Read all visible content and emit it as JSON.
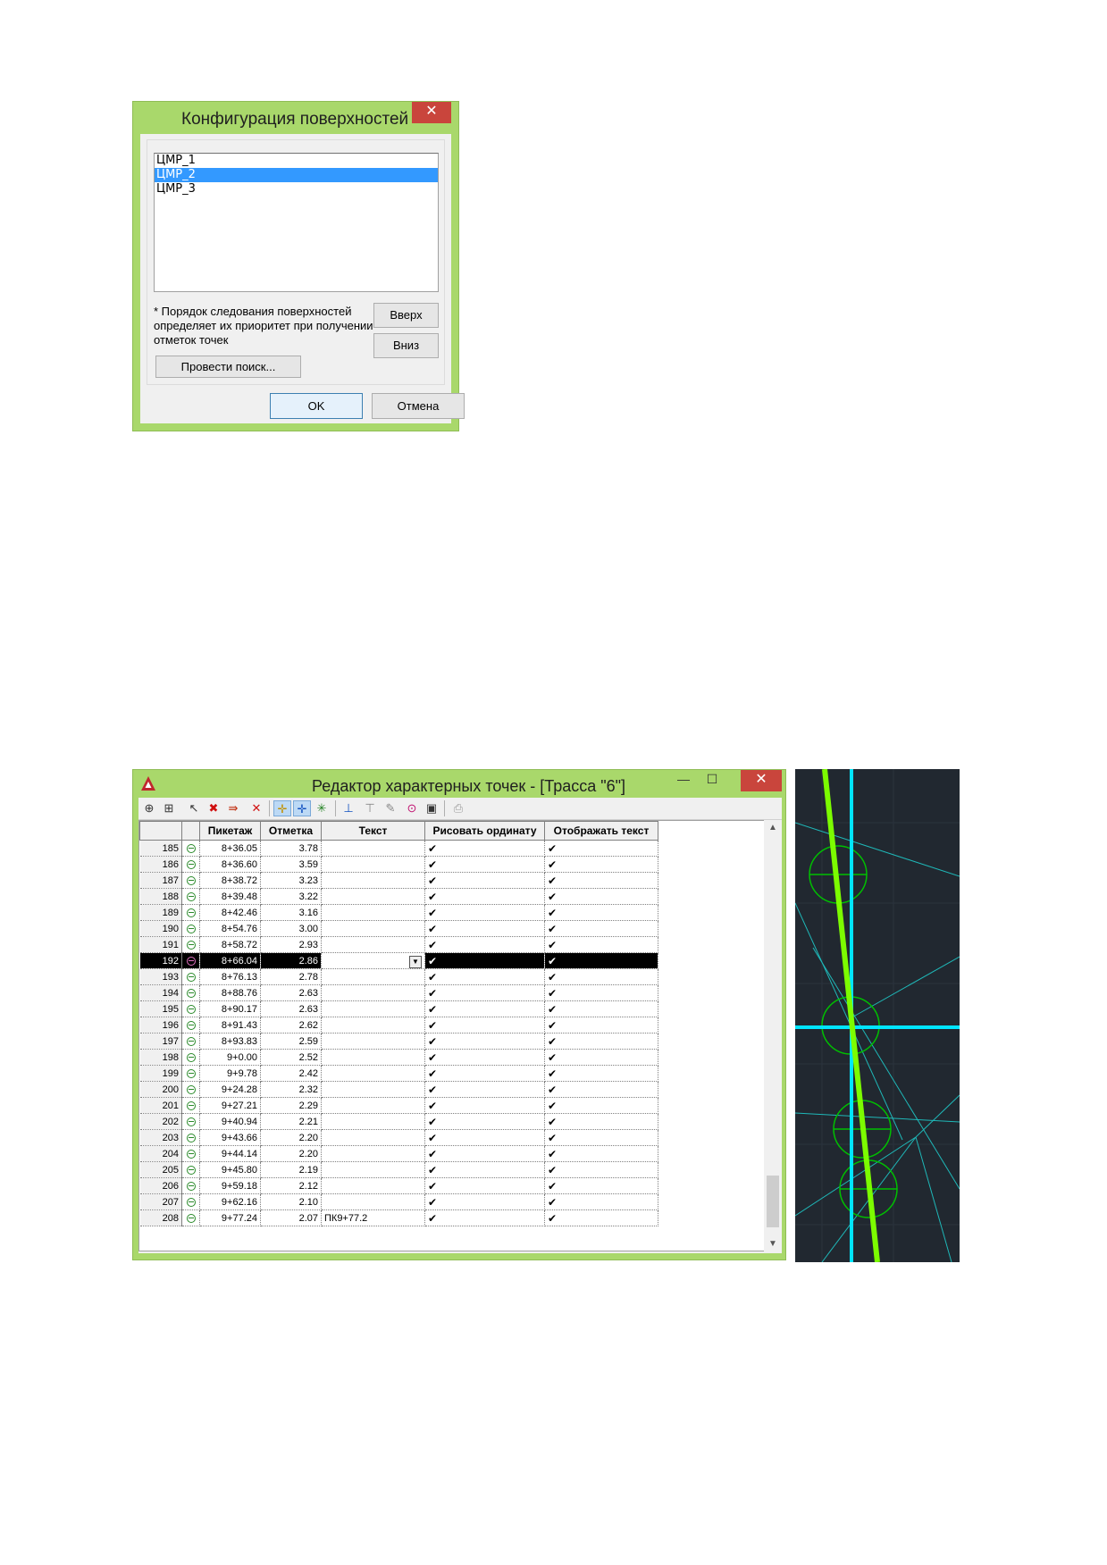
{
  "surfaces_dialog": {
    "title": "Конфигурация поверхностей",
    "close_glyph": "✕",
    "surfaces": [
      {
        "label": "ЦМР_1",
        "selected": false
      },
      {
        "label": "ЦМР_2",
        "selected": true
      },
      {
        "label": "ЦМР_3",
        "selected": false
      }
    ],
    "note": "* Порядок следования поверхностей определяет их приоритет при получении отметок точек",
    "up_button": "Вверх",
    "down_button": "Вниз",
    "search_button": "Провести поиск...",
    "ok_button": "OK",
    "cancel_button": "Отмена"
  },
  "editor_dialog": {
    "title": "Редактор характерных точек - [Трасса \"6\"]",
    "minimize_glyph": "—",
    "maximize_glyph": "☐",
    "close_glyph": "✕",
    "toolbar_icons": [
      "add-point-icon",
      "insert-point-icon",
      "select-point-icon",
      "delete-point-icon",
      "move-point-icon",
      "remove-point-icon",
      "snap-point-icon",
      "snap-node-icon",
      "snap-intersection-icon",
      "ordinate-icon",
      "ordinate-up-icon",
      "edit-icon",
      "zoom-icon",
      "export-icon",
      "print-icon"
    ],
    "columns": [
      "Пикетаж",
      "Отметка",
      "Текст",
      "Рисовать ординату",
      "Отображать текст"
    ],
    "check_glyph": "✔",
    "selected_row": 192,
    "rows": [
      {
        "n": "185",
        "station": "8+36.05",
        "elev": "3.78",
        "text": ""
      },
      {
        "n": "186",
        "station": "8+36.60",
        "elev": "3.59",
        "text": ""
      },
      {
        "n": "187",
        "station": "8+38.72",
        "elev": "3.23",
        "text": ""
      },
      {
        "n": "188",
        "station": "8+39.48",
        "elev": "3.22",
        "text": ""
      },
      {
        "n": "189",
        "station": "8+42.46",
        "elev": "3.16",
        "text": ""
      },
      {
        "n": "190",
        "station": "8+54.76",
        "elev": "3.00",
        "text": ""
      },
      {
        "n": "191",
        "station": "8+58.72",
        "elev": "2.93",
        "text": ""
      },
      {
        "n": "192",
        "station": "8+66.04",
        "elev": "2.86",
        "text": ""
      },
      {
        "n": "193",
        "station": "8+76.13",
        "elev": "2.78",
        "text": ""
      },
      {
        "n": "194",
        "station": "8+88.76",
        "elev": "2.63",
        "text": ""
      },
      {
        "n": "195",
        "station": "8+90.17",
        "elev": "2.63",
        "text": ""
      },
      {
        "n": "196",
        "station": "8+91.43",
        "elev": "2.62",
        "text": ""
      },
      {
        "n": "197",
        "station": "8+93.83",
        "elev": "2.59",
        "text": ""
      },
      {
        "n": "198",
        "station": "9+0.00",
        "elev": "2.52",
        "text": ""
      },
      {
        "n": "199",
        "station": "9+9.78",
        "elev": "2.42",
        "text": ""
      },
      {
        "n": "200",
        "station": "9+24.28",
        "elev": "2.32",
        "text": ""
      },
      {
        "n": "201",
        "station": "9+27.21",
        "elev": "2.29",
        "text": ""
      },
      {
        "n": "202",
        "station": "9+40.94",
        "elev": "2.21",
        "text": ""
      },
      {
        "n": "203",
        "station": "9+43.66",
        "elev": "2.20",
        "text": ""
      },
      {
        "n": "204",
        "station": "9+44.14",
        "elev": "2.20",
        "text": ""
      },
      {
        "n": "205",
        "station": "9+45.80",
        "elev": "2.19",
        "text": ""
      },
      {
        "n": "206",
        "station": "9+59.18",
        "elev": "2.12",
        "text": ""
      },
      {
        "n": "207",
        "station": "9+62.16",
        "elev": "2.10",
        "text": ""
      },
      {
        "n": "208",
        "station": "9+77.24",
        "elev": "2.07",
        "text": "ПК9+77.2"
      }
    ],
    "scroll_up": "▲",
    "scroll_down": "▼"
  },
  "colors": {
    "window_frame": "#a9d86b",
    "close_button": "#c9453c",
    "selection": "#3399ff",
    "cad_background": "#212830",
    "cad_alignment": "#7cfc00",
    "cad_cross": "#00e5ff"
  }
}
